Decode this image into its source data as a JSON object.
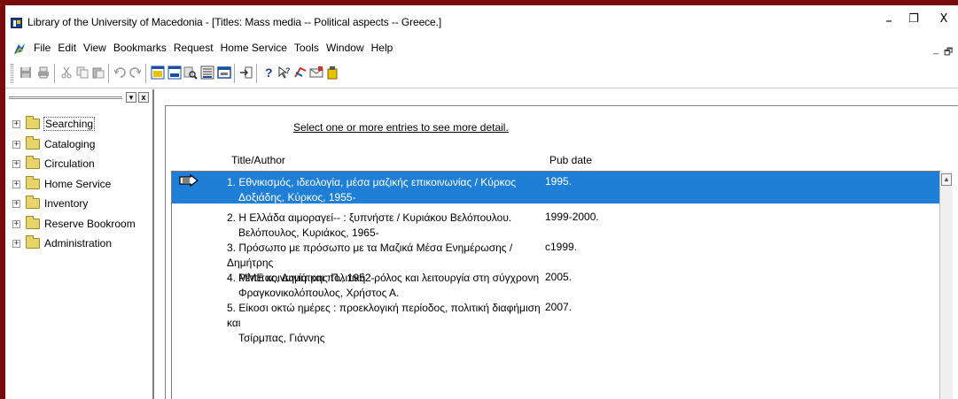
{
  "window": {
    "title": "Library of the University of Macedonia - [Titles: Mass media -- Political aspects -- Greece.]",
    "controls": {
      "minimize": "–",
      "restore": "❐",
      "close": "X"
    }
  },
  "menu": {
    "items": [
      "File",
      "Edit",
      "View",
      "Bookmarks",
      "Request",
      "Home Service",
      "Tools",
      "Window",
      "Help"
    ],
    "mdi_controls": {
      "minimize": "_",
      "restore": "🗗"
    }
  },
  "toolbar": {
    "icons": [
      "save-icon",
      "print-icon",
      "cut-icon",
      "copy-icon",
      "paste-icon",
      "undo-icon",
      "redo-icon",
      "view-single-icon",
      "view-list-icon",
      "search-tool-icon",
      "catalog-icon",
      "window-icon",
      "import-icon",
      "help-icon",
      "context-help-icon",
      "request-icon",
      "mail-icon",
      "bookroom-icon"
    ]
  },
  "sidebar": {
    "items": [
      {
        "label": "Searching",
        "selected": true
      },
      {
        "label": "Cataloging",
        "selected": false
      },
      {
        "label": "Circulation",
        "selected": false
      },
      {
        "label": "Home Service",
        "selected": false
      },
      {
        "label": "Inventory",
        "selected": false
      },
      {
        "label": "Reserve Bookroom",
        "selected": false
      },
      {
        "label": "Administration",
        "selected": false
      }
    ]
  },
  "main": {
    "instruction": "Select one or more entries to see more detail.",
    "columns": {
      "title": "Title/Author",
      "date": "Pub date"
    },
    "results": [
      {
        "line1": "1. Εθνικισμός, ιδεολογία, μέσα μαζικής επικοινωνίας / Κύρκος",
        "line2": "Δοξιάδης, Κύρκος, 1955-",
        "date": "1995.",
        "selected": true
      },
      {
        "line1": "2. Η Ελλάδα αιμοραγεί-- : ξυπνήστε / Κυριάκου Βελόπουλου.",
        "line2": "Βελόπουλος, Κυριάκος, 1965-",
        "date": "1999-2000.",
        "selected": false
      },
      {
        "line1": "3. Πρόσωπο με πρόσωπο με τα Μαζικά Μέσα Ενημέρωσης / Δημήτρης",
        "line2": "Ρέππας, Δημήτρης Π., 1952-",
        "date": "c1999.",
        "selected": false
      },
      {
        "line1": "4. ΜΜΕ κοινωνία και πολιτική : ρόλος και λειτουργία στη σύγχρονη",
        "line2": "Φραγκονικολόπουλος, Χρήστος Α.",
        "date": "2005.",
        "selected": false
      },
      {
        "line1": "5. Είκοσι οκτώ ημέρες : προεκλογική περίοδος, πολιτική διαφήμιση και",
        "line2": "Τσίρμπας, Γιάννης",
        "date": "2007.",
        "selected": false
      }
    ]
  },
  "colors": {
    "frame_border": "#7a0b0b",
    "selection": "#1f7fd6",
    "folder": "#e8d46a"
  }
}
